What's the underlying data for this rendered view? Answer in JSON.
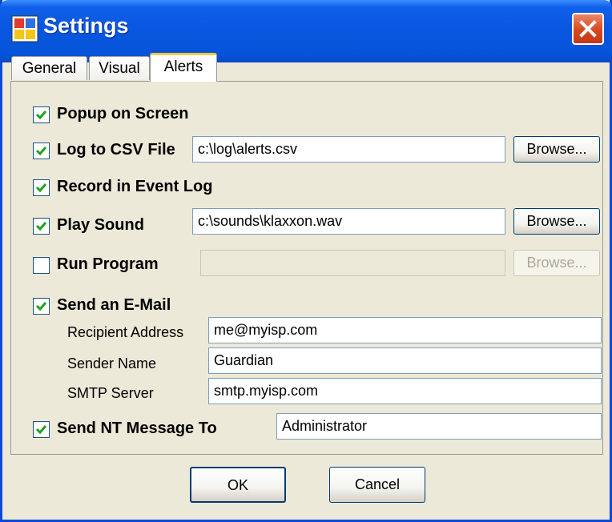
{
  "window": {
    "title": "Settings"
  },
  "tabs": [
    {
      "label": "General"
    },
    {
      "label": "Visual"
    },
    {
      "label": "Alerts"
    }
  ],
  "alerts": {
    "popup": {
      "label": "Popup on Screen",
      "checked": true
    },
    "log_csv": {
      "label": "Log to CSV File",
      "checked": true,
      "path": "c:\\log\\alerts.csv",
      "browse": "Browse..."
    },
    "event_log": {
      "label": "Record in Event Log",
      "checked": true
    },
    "play_sound": {
      "label": "Play Sound",
      "checked": true,
      "path": "c:\\sounds\\klaxxon.wav",
      "browse": "Browse..."
    },
    "run_program": {
      "label": "Run Program",
      "checked": false,
      "path": "",
      "browse": "Browse..."
    },
    "email": {
      "label": "Send an E-Mail",
      "checked": true,
      "recipient_label": "Recipient Address",
      "recipient": "me@myisp.com",
      "sender_label": "Sender Name",
      "sender": "Guardian",
      "smtp_label": "SMTP Server",
      "smtp": "smtp.myisp.com"
    },
    "nt_message": {
      "label": "Send NT Message To",
      "checked": true,
      "target": "Administrator"
    }
  },
  "buttons": {
    "ok": "OK",
    "cancel": "Cancel"
  },
  "colors": {
    "titlebar": "#0856DF",
    "checkmark": "#21A121",
    "close": "#D9471E",
    "active_tab": "#FFC83C"
  }
}
